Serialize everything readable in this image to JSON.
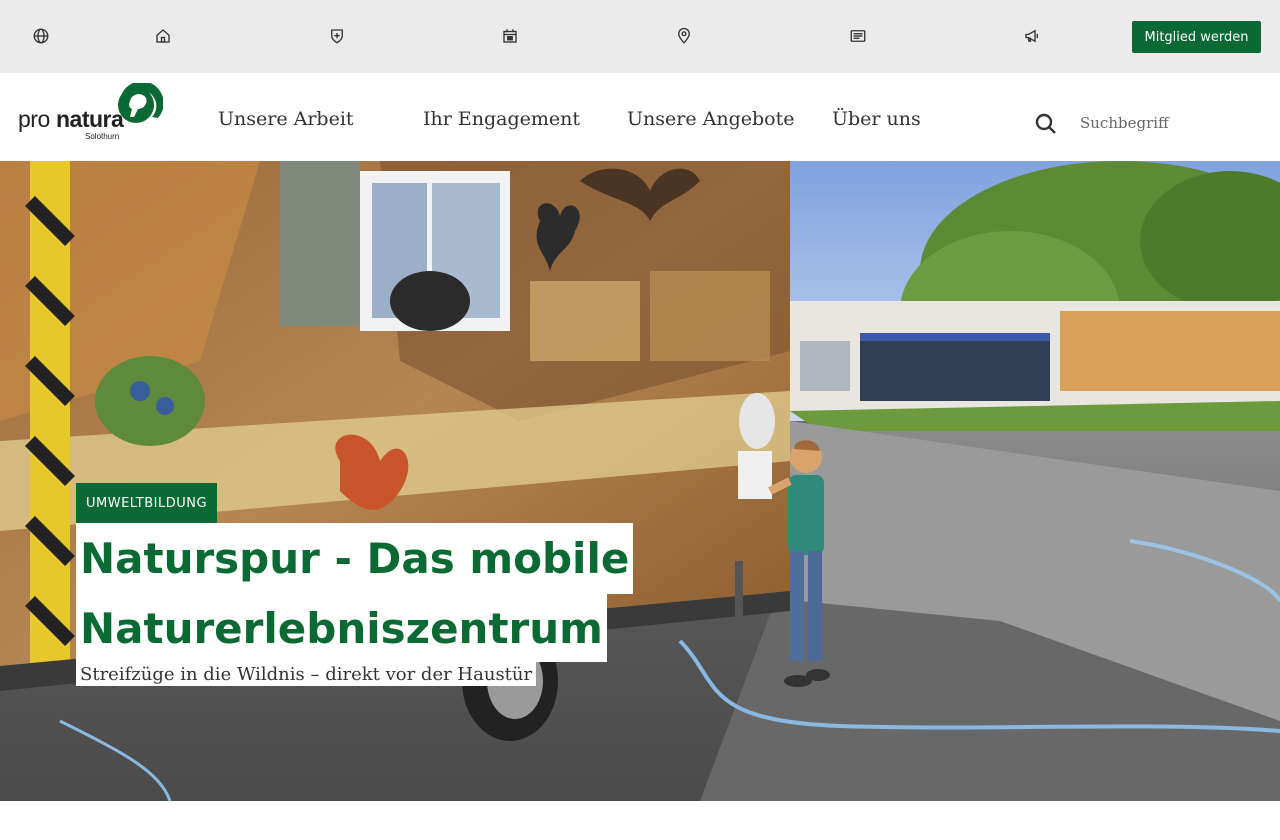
{
  "topbar": {
    "icons": [
      {
        "name": "globe-icon"
      },
      {
        "name": "home-icon"
      },
      {
        "name": "shield-plus-icon"
      },
      {
        "name": "calendar-icon"
      },
      {
        "name": "location-pin-icon"
      },
      {
        "name": "newspaper-icon"
      },
      {
        "name": "megaphone-icon"
      }
    ],
    "member_button": "Mitglied werden"
  },
  "header": {
    "logo_text": "pro natura",
    "logo_subtitle": "Solothurn",
    "nav": [
      "Unsere Arbeit",
      "Ihr Engagement",
      "Unsere Angebote",
      "Über uns"
    ],
    "search_placeholder": "Suchbegriff"
  },
  "hero": {
    "tag": "UMWELTBILDUNG",
    "headline_line1": "Naturspur - Das mobile",
    "headline_line2": "Naturerlebniszentrum",
    "subline": "Streifzüge in die Wildnis – direkt vor der Haustür"
  },
  "colors": {
    "brand_green": "#0b6a34",
    "topbar_bg": "#ebebeb"
  }
}
